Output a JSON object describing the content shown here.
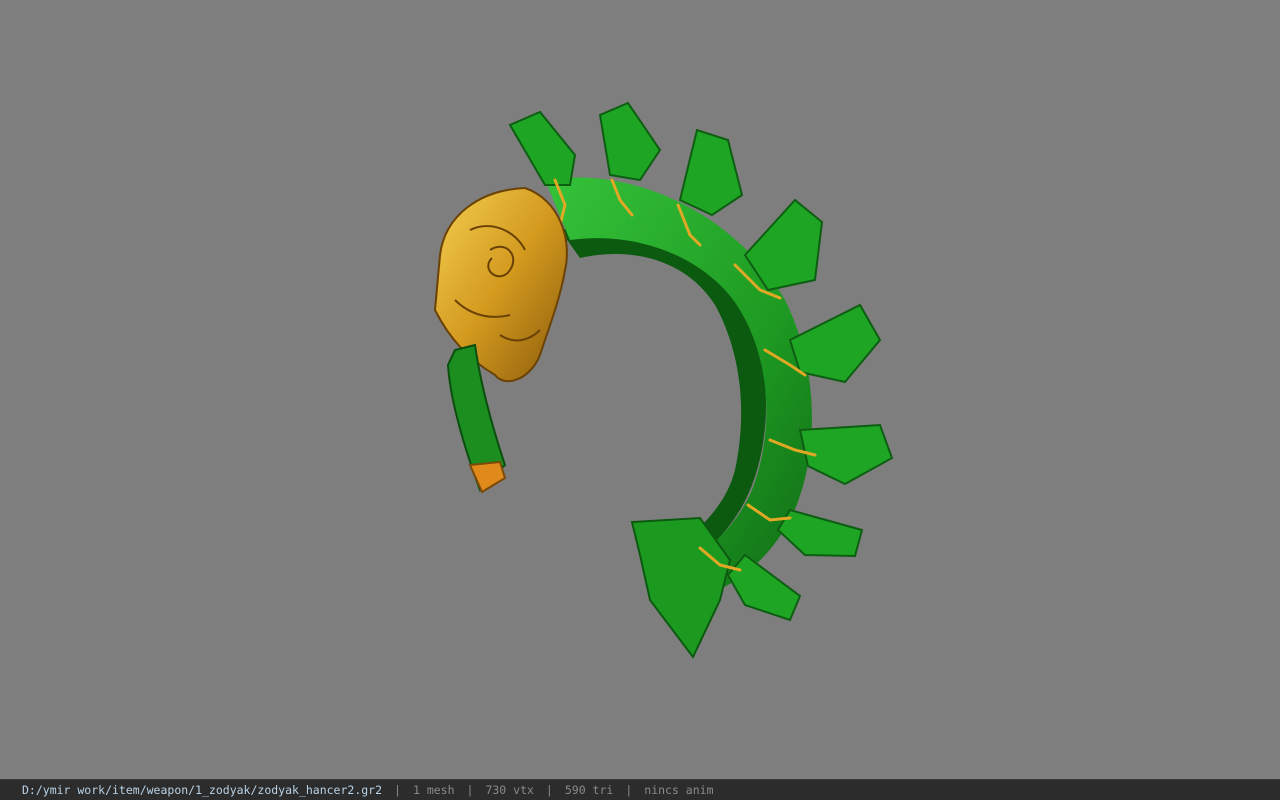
{
  "viewport": {
    "background_color": "#7e7e7e",
    "model": {
      "name": "zodyak-hancer-weapon-model",
      "primary_color": "#1f9a22",
      "dark_color": "#0c5a10",
      "accent_color": "#d7a322"
    }
  },
  "statusbar": {
    "file_path": "D:/ymir work/item/weapon/1_zodyak/zodyak_hancer2.gr2",
    "separator": "|",
    "mesh_count": "1 mesh",
    "vertex_count": "730 vtx",
    "triangle_count": "590 tri",
    "anim_status": "nincs anim"
  }
}
